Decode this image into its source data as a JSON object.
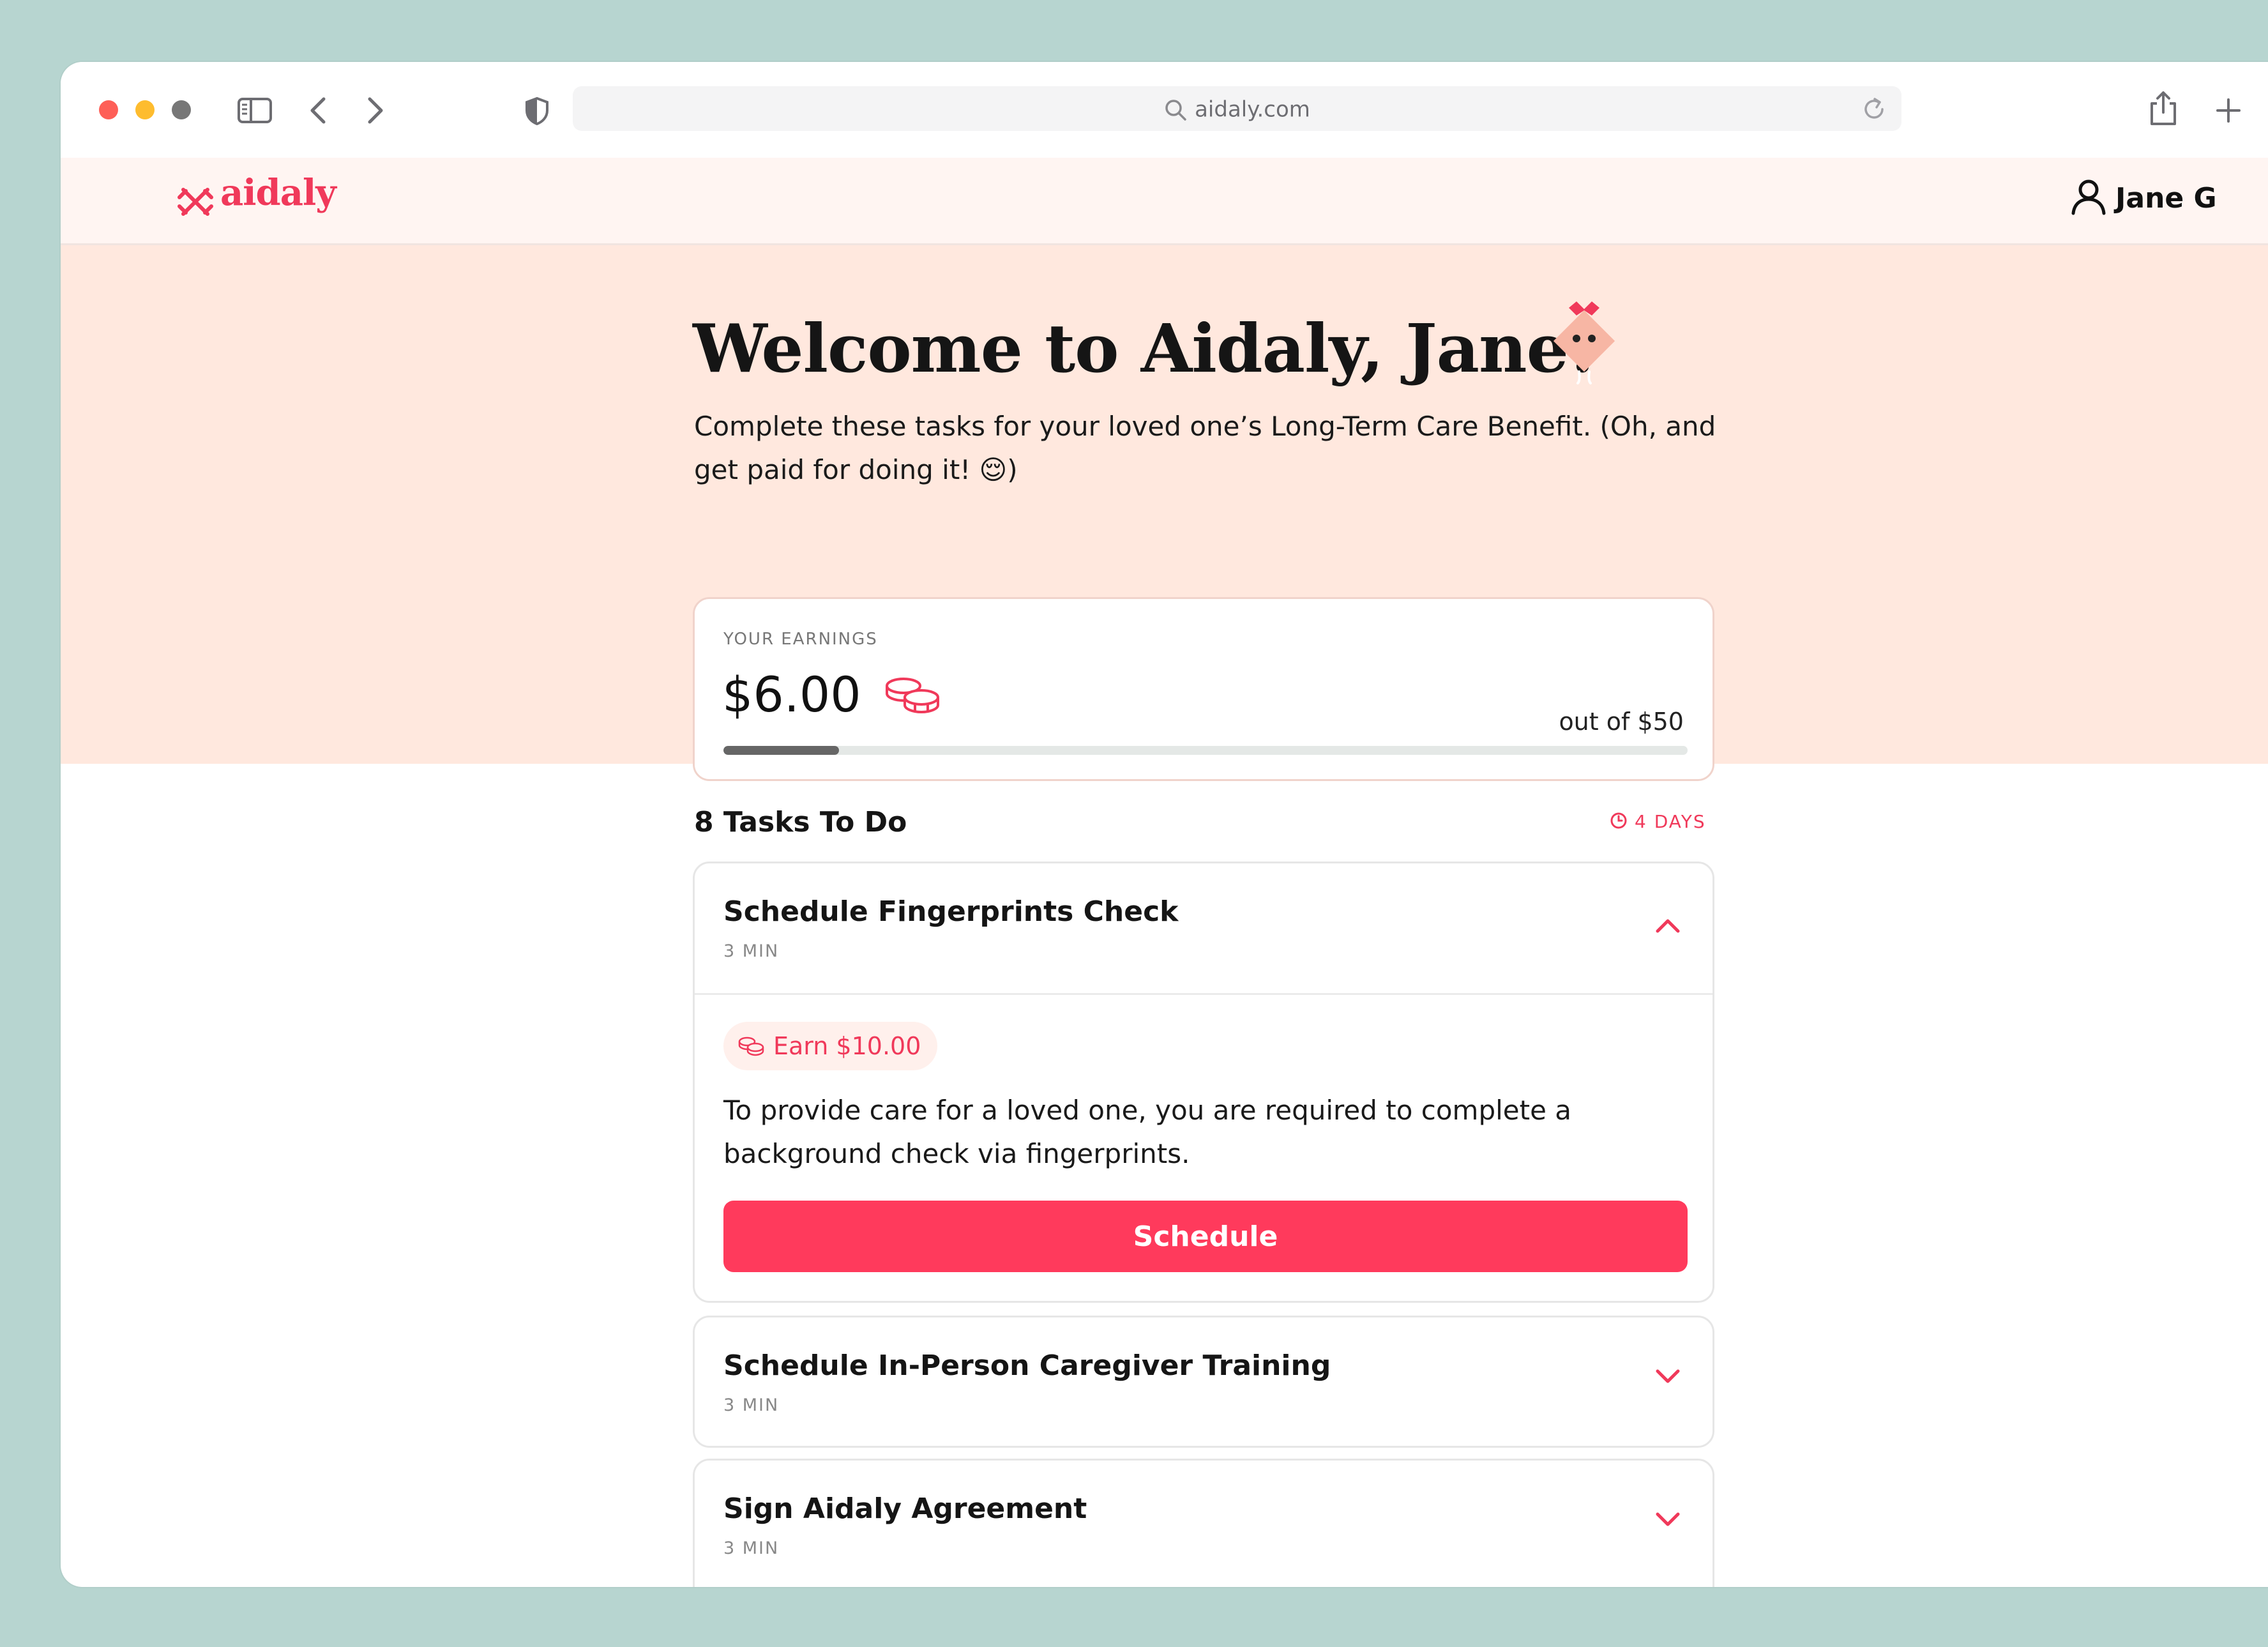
{
  "browser": {
    "url": "aidaly.com"
  },
  "header": {
    "logo_text": "aidaly",
    "user_name": "Jane G"
  },
  "hero": {
    "title": "Welcome to Aidaly, Jane!",
    "subtitle": "Complete these tasks for your loved one’s Long-Term Care Benefit. (Oh, and get paid for doing it! 😌)"
  },
  "earnings": {
    "label": "YOUR EARNINGS",
    "amount": "$6.00",
    "out_of": "out of $50",
    "progress_fraction": 0.12
  },
  "tasks": {
    "heading": "8 Tasks To Do",
    "due": "4 DAYS",
    "items": [
      {
        "title": "Schedule Fingerprints Check",
        "time": "3 MIN",
        "earn": "Earn $10.00",
        "description": "To provide care for a loved one, you are required to complete a background check via fingerprints.",
        "button": "Schedule"
      },
      {
        "title": "Schedule In-Person Caregiver Training",
        "time": "3 MIN"
      },
      {
        "title": "Sign Aidaly Agreement",
        "time": "3 MIN"
      }
    ]
  },
  "colors": {
    "accent": "#ff3a5c",
    "hero_bg": "#ffe8de",
    "header_bg": "#fff5f2",
    "frame_bg": "#b7d5d0"
  }
}
